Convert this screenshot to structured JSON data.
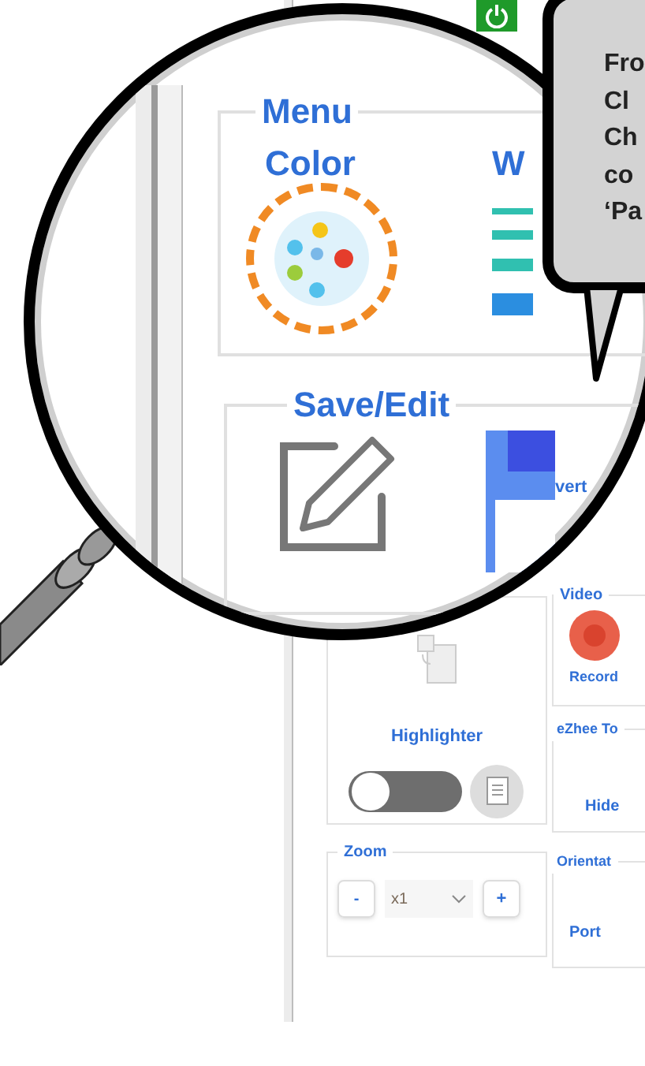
{
  "panel": {
    "highlighter": {
      "label": "Highlighter",
      "toggle": {
        "on": false
      }
    },
    "video": {
      "legend": "Video",
      "button": "Record"
    },
    "ezhee": {
      "legend": "eZhee To",
      "button": "Hide"
    },
    "zoom": {
      "legend": "Zoom",
      "minus": "-",
      "value": "x1",
      "plus": "+"
    },
    "orientation": {
      "legend": "Orientat",
      "button": "Port"
    }
  },
  "magnifier": {
    "menu": {
      "legend": "Menu",
      "items": [
        {
          "label": "Color",
          "kind": "palette",
          "highlighted": true
        },
        {
          "label": "W",
          "kind": "lines",
          "highlighted": false
        }
      ]
    },
    "save_edit": {
      "legend": "Save/Edit",
      "convert_label": "vert"
    }
  },
  "callout": {
    "text": "Fro\nCl\nCh\nco\n‘Pa"
  }
}
